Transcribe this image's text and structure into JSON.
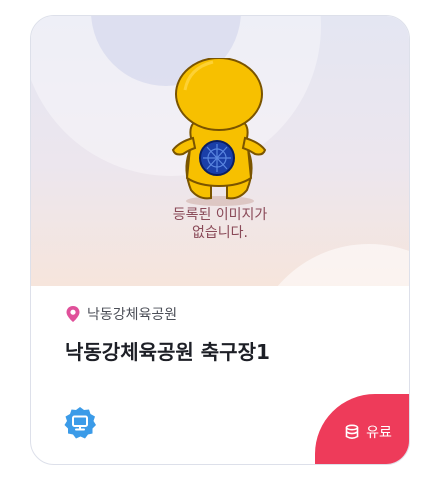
{
  "colors": {
    "paid_badge": "#ee3b5a",
    "pin": "#e0509a",
    "monitor_badge": "#3b9be8"
  },
  "image_placeholder": {
    "line1": "등록된 이미지가",
    "line2": "없습니다."
  },
  "facility": {
    "location": "낙동강체육공원",
    "name": "낙동강체육공원 축구장1"
  },
  "badges": {
    "fee": "유료",
    "monitor_icon": "monitor-icon",
    "fee_icon": "database-icon"
  }
}
